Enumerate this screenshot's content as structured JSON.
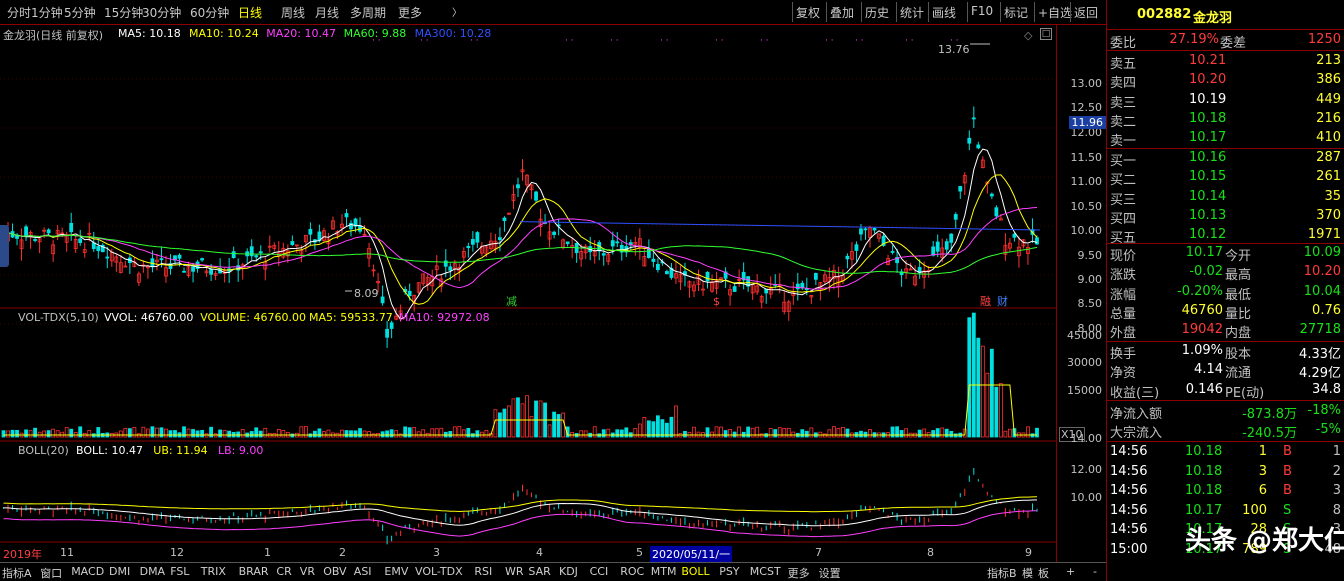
{
  "topbar": {
    "periods": [
      "分时",
      "1分钟",
      "5分钟",
      "15分钟",
      "30分钟",
      "60分钟",
      "日线",
      "周线",
      "月线",
      "多周期",
      "更多"
    ],
    "active_period": "日线",
    "right_buttons": [
      "复权",
      "叠加",
      "历史",
      "统计",
      "画线",
      "F10",
      "标记",
      "+自选",
      "返回"
    ]
  },
  "chart": {
    "title": "金龙羽(日线 前复权)",
    "ma_labels": [
      {
        "text": "MA5: 10.18",
        "color": "#ffffff"
      },
      {
        "text": "MA10: 10.24",
        "color": "#ffff00"
      },
      {
        "text": "MA20: 10.47",
        "color": "#ff40ff"
      },
      {
        "text": "MA60: 9.88",
        "color": "#30ff30"
      },
      {
        "text": "MA300: 10.28",
        "color": "#3050ff"
      }
    ],
    "high_marker": "13.76",
    "low_marker": "8.09",
    "current_price_tag": "11.96",
    "price_ticks": [
      "13.00",
      "12.50",
      "12.00",
      "11.50",
      "11.00",
      "10.50",
      "10.00",
      "9.50",
      "9.00",
      "8.50",
      "8.00"
    ],
    "event_marks": [
      "减",
      "$",
      "融",
      "财"
    ],
    "vol_title": "VOL-TDX(5,10)",
    "vol_labels": [
      {
        "text": "VVOL: 46760.00",
        "color": "#ffffff"
      },
      {
        "text": "VOLUME: 46760.00",
        "color": "#ffff00"
      },
      {
        "text": "MA5: 59533.77",
        "color": "#ffff00"
      },
      {
        "text": "MA10: 92972.08",
        "color": "#ff40ff"
      }
    ],
    "vol_ticks": [
      "45000",
      "30000",
      "15000"
    ],
    "vol_unit": "X10",
    "boll_title": "BOLL(20)",
    "boll_labels": [
      {
        "text": "BOLL: 10.47",
        "color": "#ffffff"
      },
      {
        "text": "UB: 11.94",
        "color": "#ffff00"
      },
      {
        "text": "LB: 9.00",
        "color": "#ff40ff"
      }
    ],
    "boll_ticks": [
      "14.00",
      "12.00",
      "10.00"
    ],
    "dates": [
      "2019年",
      "11",
      "12",
      "1",
      "2",
      "3",
      "4",
      "5",
      "2020/05/11/一",
      "7",
      "8",
      "9"
    ]
  },
  "quote": {
    "code": "002882",
    "name": "金龙羽",
    "weibi_label": "委比",
    "weibi": "27.19%",
    "weicha_label": "委差",
    "weicha": "1250",
    "asks": [
      {
        "label": "卖五",
        "price": "10.21",
        "vol": "213"
      },
      {
        "label": "卖四",
        "price": "10.20",
        "vol": "386"
      },
      {
        "label": "卖三",
        "price": "10.19",
        "vol": "449"
      },
      {
        "label": "卖二",
        "price": "10.18",
        "vol": "216"
      },
      {
        "label": "卖一",
        "price": "10.17",
        "vol": "410"
      }
    ],
    "bids": [
      {
        "label": "买一",
        "price": "10.16",
        "vol": "287"
      },
      {
        "label": "买二",
        "price": "10.15",
        "vol": "261"
      },
      {
        "label": "买三",
        "price": "10.14",
        "vol": "35"
      },
      {
        "label": "买四",
        "price": "10.13",
        "vol": "370"
      },
      {
        "label": "买五",
        "price": "10.12",
        "vol": "1971"
      }
    ],
    "stats": [
      {
        "l1": "现价",
        "v1": "10.17",
        "c1": "grn",
        "l2": "今开",
        "v2": "10.09",
        "c2": "grn"
      },
      {
        "l1": "涨跌",
        "v1": "-0.02",
        "c1": "grn",
        "l2": "最高",
        "v2": "10.20",
        "c2": "red"
      },
      {
        "l1": "涨幅",
        "v1": "-0.20%",
        "c1": "grn",
        "l2": "最低",
        "v2": "10.04",
        "c2": "grn"
      },
      {
        "l1": "总量",
        "v1": "46760",
        "c1": "yel",
        "l2": "量比",
        "v2": "0.76",
        "c2": "yel"
      },
      {
        "l1": "外盘",
        "v1": "19042",
        "c1": "red",
        "l2": "内盘",
        "v2": "27718",
        "c2": "grn"
      }
    ],
    "fundamentals": [
      {
        "l1": "换手",
        "v1": "1.09%",
        "l2": "股本",
        "v2": "4.33亿"
      },
      {
        "l1": "净资",
        "v1": "4.14",
        "l2": "流通",
        "v2": "4.29亿"
      },
      {
        "l1": "收益(三)",
        "v1": "0.146",
        "l2": "PE(动)",
        "v2": "34.8"
      }
    ],
    "flows": [
      {
        "label": "净流入额",
        "value": "-873.8万",
        "pct": "-18%"
      },
      {
        "label": "大宗流入",
        "value": "-240.5万",
        "pct": "-5%"
      }
    ],
    "ticks": [
      {
        "time": "14:56",
        "price": "10.18",
        "vol": "1",
        "side": "B",
        "n": "1"
      },
      {
        "time": "14:56",
        "price": "10.18",
        "vol": "3",
        "side": "B",
        "n": "2"
      },
      {
        "time": "14:56",
        "price": "10.18",
        "vol": "6",
        "side": "B",
        "n": "3"
      },
      {
        "time": "14:56",
        "price": "10.17",
        "vol": "100",
        "side": "S",
        "n": "8"
      },
      {
        "time": "14:56",
        "price": "10.17",
        "vol": "28",
        "side": "S",
        "n": "3"
      },
      {
        "time": "15:00",
        "price": "10.17",
        "vol": "789",
        "side": "S",
        "n": "48"
      }
    ]
  },
  "bottombar": {
    "left": [
      "指标A",
      "窗口",
      "MACD",
      "DMI",
      "DMA",
      "FSL",
      "TRIX",
      "BRAR",
      "CR",
      "VR",
      "OBV",
      "ASI",
      "EMV",
      "VOL-TDX",
      "RSI",
      "WR",
      "SAR",
      "KDJ",
      "CCI",
      "ROC",
      "MTM",
      "BOLL",
      "PSY",
      "MCST",
      "更多",
      "设置"
    ],
    "active": "BOLL",
    "right": [
      "指标B",
      "模",
      "板",
      "+",
      "-"
    ]
  },
  "watermark": "头条 @郑大仁评论"
}
